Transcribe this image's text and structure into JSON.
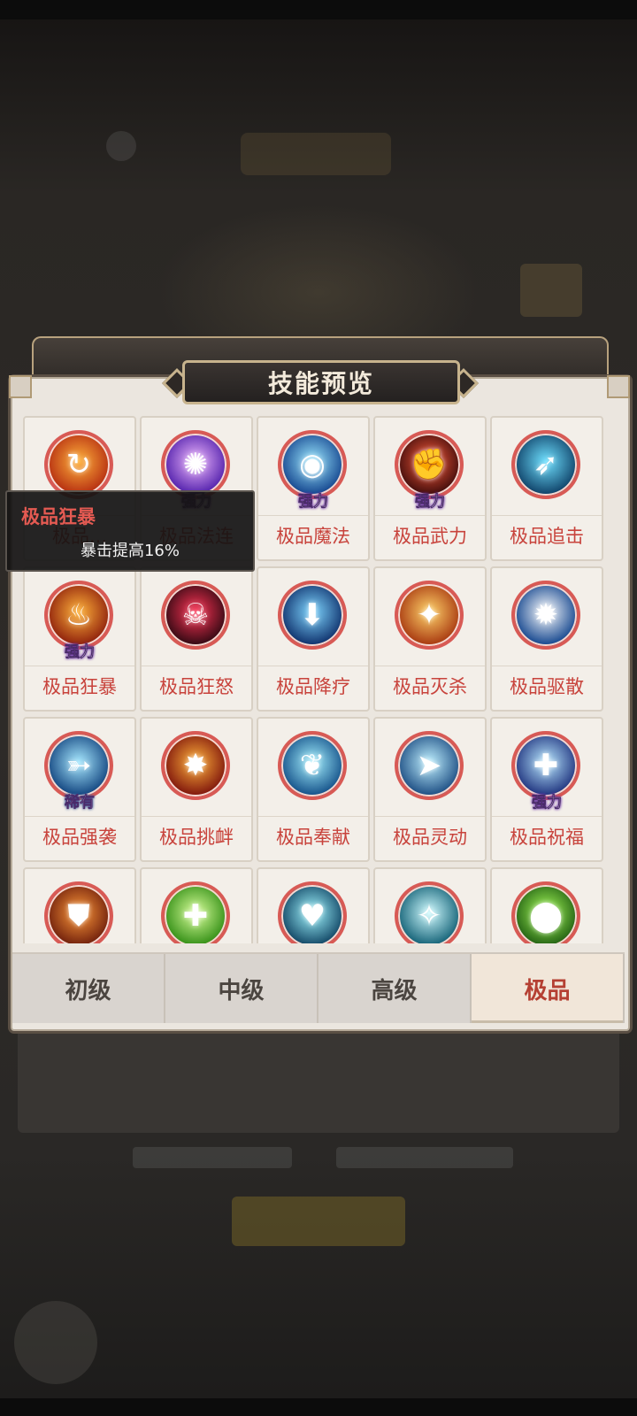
{
  "dialog": {
    "title": "技能预览"
  },
  "tooltip": {
    "title": "极品狂暴",
    "description": "暴击提高16%"
  },
  "skills": [
    {
      "name": "极品...",
      "badge": "",
      "icon": "flame-swirl-icon",
      "colors": [
        "#ffb13b",
        "#b2280f"
      ]
    },
    {
      "name": "极品法连",
      "badge": "强力",
      "icon": "purple-orb-icon",
      "colors": [
        "#f0b8ff",
        "#4b1aa8"
      ]
    },
    {
      "name": "极品魔法",
      "badge": "强力",
      "icon": "water-orb-icon",
      "colors": [
        "#9be8ff",
        "#0f3f8a"
      ]
    },
    {
      "name": "极品武力",
      "badge": "强力",
      "icon": "fist-icon",
      "colors": [
        "#ff5b3a",
        "#3a0a0a"
      ]
    },
    {
      "name": "极品追击",
      "badge": "",
      "icon": "runner-icon",
      "colors": [
        "#6fe0ff",
        "#0b3b62"
      ]
    },
    {
      "name": "极品狂暴",
      "badge": "强力",
      "icon": "rage-flame-icon",
      "colors": [
        "#ffb23a",
        "#8a1a0a"
      ]
    },
    {
      "name": "极品狂怒",
      "badge": "",
      "icon": "demon-face-icon",
      "colors": [
        "#ff3355",
        "#2a0810"
      ]
    },
    {
      "name": "极品降疗",
      "badge": "",
      "icon": "down-arrow-icon",
      "colors": [
        "#7fd6ff",
        "#0a2a66"
      ]
    },
    {
      "name": "极品灭杀",
      "badge": "",
      "icon": "fire-warrior-icon",
      "colors": [
        "#ffd36a",
        "#a4320c"
      ]
    },
    {
      "name": "极品驱散",
      "badge": "",
      "icon": "light-burst-icon",
      "colors": [
        "#ffffff",
        "#0b3f8a"
      ]
    },
    {
      "name": "极品强袭",
      "badge": "稀有",
      "icon": "feather-strike-icon",
      "colors": [
        "#a7e8ff",
        "#0c3e7a"
      ]
    },
    {
      "name": "极品挑衅",
      "badge": "",
      "icon": "taunt-beast-icon",
      "colors": [
        "#ffb13b",
        "#7a0f0a"
      ]
    },
    {
      "name": "极品奉献",
      "badge": "",
      "icon": "angel-wing-icon",
      "colors": [
        "#a4f1ff",
        "#0e4a84"
      ]
    },
    {
      "name": "极品灵动",
      "badge": "",
      "icon": "dash-icon",
      "colors": [
        "#bff0ff",
        "#16477e"
      ]
    },
    {
      "name": "极品祝福",
      "badge": "强力",
      "icon": "sparkle-cross-icon",
      "colors": [
        "#b8e8ff",
        "#1a2d7a"
      ]
    },
    {
      "name": "",
      "badge": "",
      "icon": "armor-chest-icon",
      "colors": [
        "#ff9a3a",
        "#6a1a0a"
      ]
    },
    {
      "name": "",
      "badge": "",
      "icon": "heal-cross-icon",
      "colors": [
        "#d9ff9a",
        "#2c8a10"
      ]
    },
    {
      "name": "",
      "badge": "",
      "icon": "halo-heart-icon",
      "colors": [
        "#a0f6ff",
        "#0b3e5e"
      ]
    },
    {
      "name": "",
      "badge": "",
      "icon": "light-pillar-icon",
      "colors": [
        "#d0fbff",
        "#0a5a70"
      ]
    },
    {
      "name": "",
      "badge": "",
      "icon": "green-potion-icon",
      "colors": [
        "#a8ff5a",
        "#1d5a10"
      ]
    }
  ],
  "tabs": [
    {
      "label": "初级",
      "active": false
    },
    {
      "label": "中级",
      "active": false
    },
    {
      "label": "高级",
      "active": false
    },
    {
      "label": "极品",
      "active": true
    }
  ]
}
